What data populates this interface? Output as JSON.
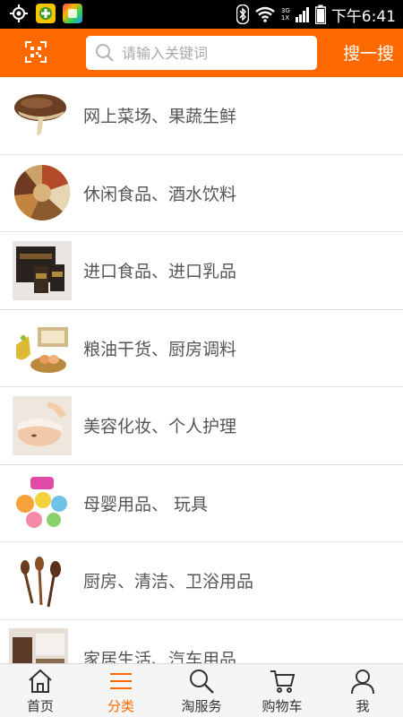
{
  "status_bar": {
    "time": "下午6:41",
    "network_top": "3G",
    "network_bottom": "1X",
    "icons": [
      "gps-icon",
      "app-icon",
      "app-icon",
      "bluetooth-icon",
      "wifi-icon",
      "signal-icon",
      "battery-icon"
    ]
  },
  "header": {
    "scan_icon": "scan-icon",
    "search_placeholder": "请输入关键词",
    "search_button": "搜一搜",
    "accent_color": "#ff6a00"
  },
  "categories": [
    {
      "label": "网上菜场、果蔬生鲜",
      "icon": "mushroom"
    },
    {
      "label": "休闲食品、酒水饮料",
      "icon": "nuts"
    },
    {
      "label": "进口食品、进口乳品",
      "icon": "imported-box"
    },
    {
      "label": "粮油干货、厨房调料",
      "icon": "oil-eggs"
    },
    {
      "label": "美容化妆、个人护理",
      "icon": "spa-face"
    },
    {
      "label": "母婴用品、 玩具",
      "icon": "toys"
    },
    {
      "label": "厨房、清洁、卫浴用品",
      "icon": "spoons"
    },
    {
      "label": "家居生活、汽车用品",
      "icon": "home"
    }
  ],
  "tabbar": {
    "tabs": [
      {
        "label": "首页",
        "icon": "home-icon",
        "active": false
      },
      {
        "label": "分类",
        "icon": "menu-icon",
        "active": true
      },
      {
        "label": "淘服务",
        "icon": "search-icon",
        "active": false
      },
      {
        "label": "购物车",
        "icon": "cart-icon",
        "active": false
      },
      {
        "label": "我",
        "icon": "user-icon",
        "active": false
      }
    ]
  }
}
